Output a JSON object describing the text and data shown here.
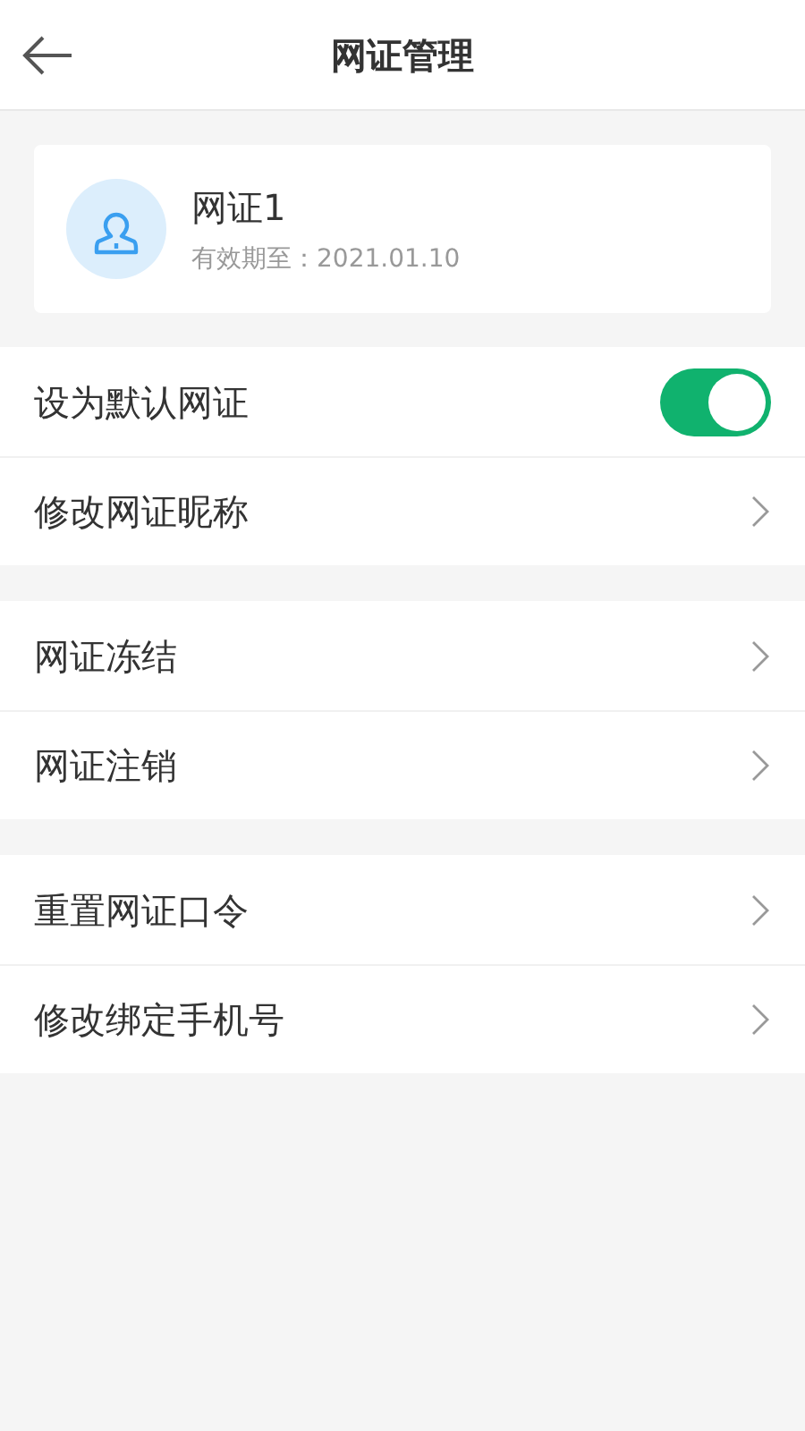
{
  "header": {
    "title": "网证管理"
  },
  "card": {
    "name": "网证1",
    "expiry": "有效期至：2021.01.10"
  },
  "groups": [
    {
      "rows": [
        {
          "label": "设为默认网证",
          "kind": "toggle",
          "on": true
        },
        {
          "label": "修改网证昵称",
          "kind": "link"
        }
      ]
    },
    {
      "rows": [
        {
          "label": "网证冻结",
          "kind": "link"
        },
        {
          "label": "网证注销",
          "kind": "link"
        }
      ]
    },
    {
      "rows": [
        {
          "label": "重置网证口令",
          "kind": "link"
        },
        {
          "label": "修改绑定手机号",
          "kind": "link"
        }
      ]
    }
  ]
}
